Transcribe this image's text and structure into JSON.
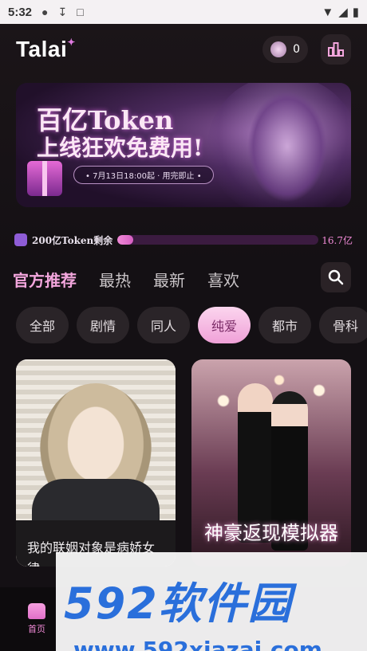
{
  "status_bar": {
    "time": "5:32",
    "icons": [
      "alert-icon",
      "download-icon",
      "a-icon"
    ],
    "right_icons": [
      "wifi-icon",
      "signal-icon",
      "battery-icon"
    ]
  },
  "header": {
    "logo": "Talai",
    "coins": "0"
  },
  "banner": {
    "line1": "百亿Token",
    "line2": "上线狂欢免费用!",
    "date": "• 7月13日18:00起 · 用完即止 •"
  },
  "token": {
    "label": "200亿Token剩余",
    "remaining": "16.7亿",
    "progress_fraction": 0.08
  },
  "tabs": [
    {
      "label": "官方推荐",
      "active": true
    },
    {
      "label": "最热",
      "active": false
    },
    {
      "label": "最新",
      "active": false
    },
    {
      "label": "喜欢",
      "active": false
    }
  ],
  "chips": [
    {
      "label": "全部",
      "active": false
    },
    {
      "label": "剧情",
      "active": false
    },
    {
      "label": "同人",
      "active": false
    },
    {
      "label": "纯爱",
      "active": true
    },
    {
      "label": "都市",
      "active": false
    },
    {
      "label": "骨科",
      "active": false
    }
  ],
  "cards": [
    {
      "caption": "我的联姻对象是病娇女律"
    },
    {
      "title": "神豪返现模拟器"
    }
  ],
  "bottom_nav": {
    "home_label": "首页"
  },
  "watermark": {
    "big": "592软件园",
    "url": "www.592xiazai.com"
  },
  "colors": {
    "accent": "#f08ad6",
    "background": "#141014",
    "watermark": "#2a6fdb"
  }
}
